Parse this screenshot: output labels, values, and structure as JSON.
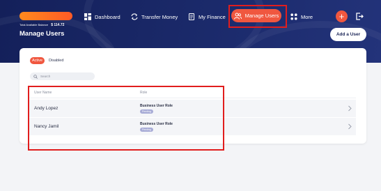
{
  "header": {
    "balance_label": "Total Available Balance",
    "balance_value": "$ 114.72",
    "brand_color": "#ff6a22",
    "nav": {
      "dashboard": "Dashboard",
      "transfer_money": "Transfer Money",
      "my_finance": "My Finance",
      "manage_users": "Manage Users",
      "more": "More"
    },
    "plus_label": "+"
  },
  "page": {
    "title": "Manage Users",
    "add_user_label": "Add a User"
  },
  "tabs": {
    "active": "Active",
    "disabled": "Disabled"
  },
  "search": {
    "placeholder": "Search"
  },
  "table": {
    "columns": [
      "User Name",
      "Role"
    ],
    "rows": [
      {
        "name": "Andy Lopez",
        "role": "Business User Role",
        "badge": "Pending"
      },
      {
        "name": "Nancy Jamil",
        "role": "Business User Role",
        "badge": "Pending"
      }
    ]
  },
  "colors": {
    "accent": "#f0573f",
    "header_bg": "#1b2a6b",
    "highlight": "#e11d1d",
    "badge": "#a7abd6"
  }
}
